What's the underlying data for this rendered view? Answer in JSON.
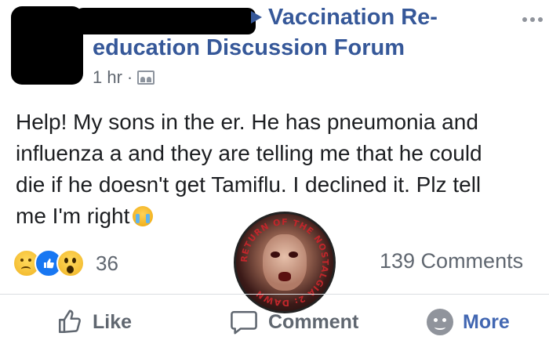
{
  "post": {
    "group_name_line1": "Vaccination Re-",
    "group_name_line2": "education Discussion Forum",
    "time": "1 hr",
    "separator": "·",
    "privacy_icon": "group-icon",
    "more_icon": "ellipsis-icon",
    "text_lines": [
      "Help! My sons in the er. He has pneumonia and",
      "influenza a and they are telling me that he could",
      "die if he doesn't get Tamiflu. I declined it. Plz tell",
      "me I'm right"
    ],
    "text_emoji": "crying-face-icon"
  },
  "reactions": {
    "icons": [
      "sad-reaction-icon",
      "like-reaction-icon",
      "wow-reaction-icon"
    ],
    "count": "36",
    "comments": "139 Comments"
  },
  "badge": {
    "text": "RETURN OF THE NOSTALGIA 2: DAWN",
    "icon": "return-of-the-dawn-badge"
  },
  "actions": {
    "like_label": "Like",
    "comment_label": "Comment",
    "more_label": "More"
  },
  "colors": {
    "link": "#365899",
    "secondary_text": "#606770",
    "body_text": "#1c1e21",
    "more_blue": "#4267b2"
  }
}
